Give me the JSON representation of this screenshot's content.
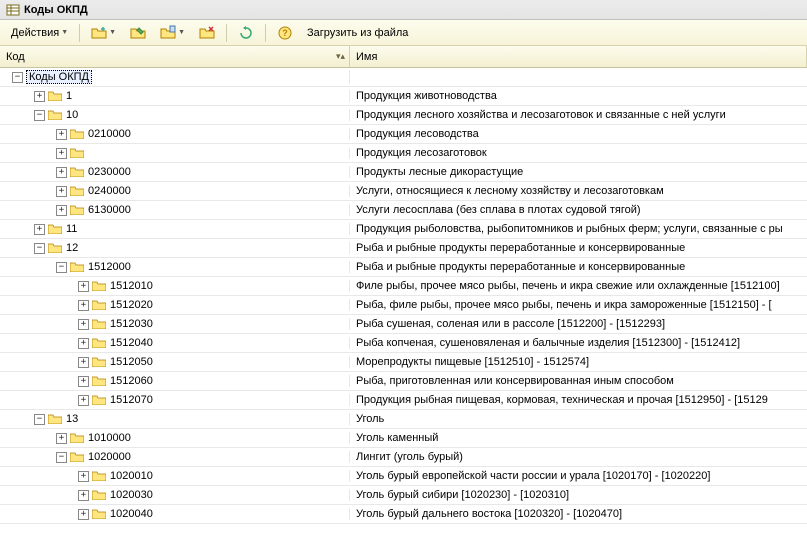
{
  "window": {
    "title": "Коды ОКПД"
  },
  "toolbar": {
    "actions_label": "Действия",
    "load_label": "Загрузить из файла"
  },
  "columns": {
    "code": "Код",
    "name": "Имя"
  },
  "tree": [
    {
      "level": 0,
      "expander": "-",
      "code": "Коды ОКПД",
      "name": "",
      "selected": true
    },
    {
      "level": 1,
      "expander": "+",
      "folder": true,
      "code": "1",
      "name": "Продукция животноводства"
    },
    {
      "level": 1,
      "expander": "-",
      "folder": true,
      "code": "10",
      "name": "Продукция лесного хозяйства и лесозаготовок и связанные с ней услуги"
    },
    {
      "level": 2,
      "expander": "+",
      "folder": true,
      "code": "0210000",
      "name": "Продукция лесоводства"
    },
    {
      "level": 2,
      "expander": "+",
      "folder": true,
      "code": "",
      "name": "Продукция лесозаготовок"
    },
    {
      "level": 2,
      "expander": "+",
      "folder": true,
      "code": "0230000",
      "name": "Продукты лесные дикорастущие"
    },
    {
      "level": 2,
      "expander": "+",
      "folder": true,
      "code": "0240000",
      "name": "Услуги, относящиеся к лесному хозяйству и лесозаготовкам"
    },
    {
      "level": 2,
      "expander": "+",
      "folder": true,
      "code": "6130000",
      "name": "Услуги лесосплава (без сплава в плотах судовой тягой)"
    },
    {
      "level": 1,
      "expander": "+",
      "folder": true,
      "code": "11",
      "name": "Продукция рыболовства, рыбопитомников и рыбных ферм; услуги, связанные с ры"
    },
    {
      "level": 1,
      "expander": "-",
      "folder": true,
      "code": "12",
      "name": "Рыба и рыбные продукты переработанные и консервированные"
    },
    {
      "level": 2,
      "expander": "-",
      "folder": true,
      "code": "1512000",
      "name": "Рыба и рыбные продукты переработанные и консервированные"
    },
    {
      "level": 3,
      "expander": "+",
      "folder": true,
      "code": "1512010",
      "name": "Филе рыбы, прочее мясо рыбы, печень и икра свежие или охлажденные [1512100]"
    },
    {
      "level": 3,
      "expander": "+",
      "folder": true,
      "code": "1512020",
      "name": "Рыба, филе рыбы, прочее мясо рыбы, печень и икра замороженные [1512150] - ["
    },
    {
      "level": 3,
      "expander": "+",
      "folder": true,
      "code": "1512030",
      "name": "Рыба сушеная, соленая или в рассоле [1512200] - [1512293]"
    },
    {
      "level": 3,
      "expander": "+",
      "folder": true,
      "code": "1512040",
      "name": "Рыба копченая, сушеновяленая и балычные изделия [1512300] - [1512412]"
    },
    {
      "level": 3,
      "expander": "+",
      "folder": true,
      "code": "1512050",
      "name": "Морепродукты пищевые [1512510] - 1512574]"
    },
    {
      "level": 3,
      "expander": "+",
      "folder": true,
      "code": "1512060",
      "name": "Рыба, приготовленная или консервированная иным способом"
    },
    {
      "level": 3,
      "expander": "+",
      "folder": true,
      "code": "1512070",
      "name": "Продукция рыбная пищевая, кормовая, техническая и прочая [1512950] - [15129"
    },
    {
      "level": 1,
      "expander": "-",
      "folder": true,
      "code": "13",
      "name": "Уголь"
    },
    {
      "level": 2,
      "expander": "+",
      "folder": true,
      "code": "1010000",
      "name": "Уголь каменный"
    },
    {
      "level": 2,
      "expander": "-",
      "folder": true,
      "code": "1020000",
      "name": "Лингит (уголь бурый)"
    },
    {
      "level": 3,
      "expander": "+",
      "folder": true,
      "code": "1020010",
      "name": "Уголь бурый европейской части россии и урала [1020170] - [1020220]"
    },
    {
      "level": 3,
      "expander": "+",
      "folder": true,
      "code": "1020030",
      "name": "Уголь бурый сибири [1020230] - [1020310]"
    },
    {
      "level": 3,
      "expander": "+",
      "folder": true,
      "code": "1020040",
      "name": "Уголь бурый дальнего востока [1020320] - [1020470]"
    }
  ]
}
